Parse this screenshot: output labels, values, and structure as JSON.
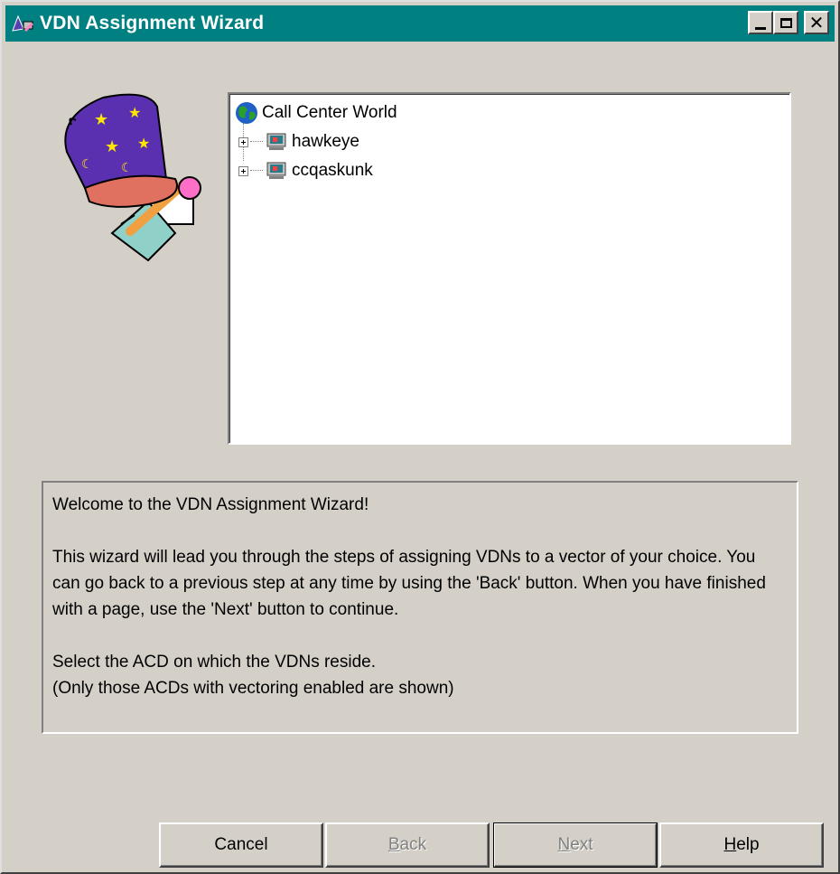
{
  "window": {
    "title": "VDN Assignment Wizard",
    "controls": {
      "minimize": "minimize",
      "maximize": "maximize",
      "close": "close"
    }
  },
  "tree": {
    "root": {
      "label": "Call Center World",
      "icon": "globe-icon"
    },
    "nodes": [
      {
        "label": "hawkeye",
        "icon": "acd-icon",
        "expandable": true
      },
      {
        "label": "ccqaskunk",
        "icon": "acd-icon",
        "expandable": true
      }
    ]
  },
  "description": {
    "welcome": "Welcome to the VDN Assignment Wizard!",
    "body": "This wizard will lead you through the steps of assigning VDNs to a vector of your choice. You can go back to a previous step at any time by using the 'Back' button. When you have finished with a page, use the 'Next' button to continue.",
    "instruction": "Select the ACD on which the VDNs reside.",
    "note": "(Only those ACDs with vectoring enabled are shown)"
  },
  "buttons": {
    "cancel": "Cancel",
    "back_mnemonic": "B",
    "back_rest": "ack",
    "next_mnemonic": "N",
    "next_rest": "ext",
    "help_mnemonic": "H",
    "help_rest": "elp"
  },
  "colors": {
    "titlebar": "#008080",
    "dialog_face": "#d4d0c8",
    "disabled_text": "#808080"
  }
}
